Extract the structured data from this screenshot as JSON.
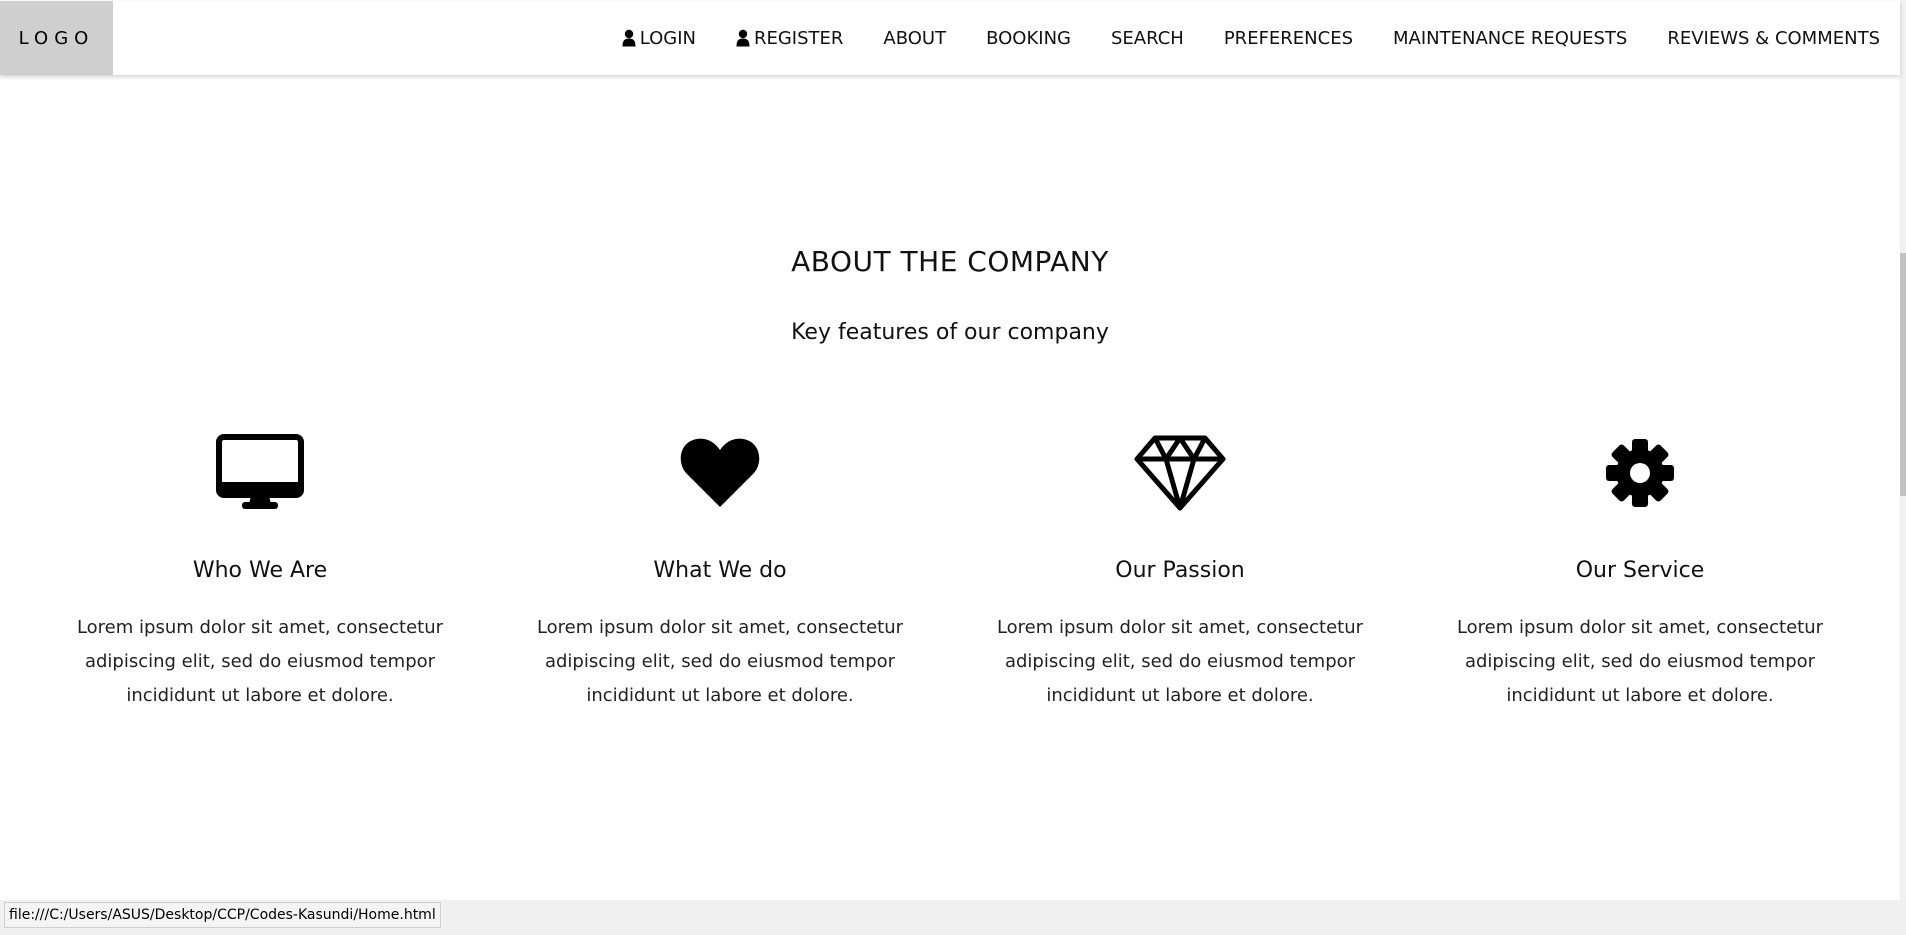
{
  "navbar": {
    "logo": "LOGO",
    "links": [
      {
        "label": "LOGIN",
        "icon": "user-icon"
      },
      {
        "label": "REGISTER",
        "icon": "user-icon"
      },
      {
        "label": "ABOUT"
      },
      {
        "label": "BOOKING"
      },
      {
        "label": "SEARCH"
      },
      {
        "label": "PREFERENCES"
      },
      {
        "label": "MAINTENANCE REQUESTS"
      },
      {
        "label": "REVIEWS & COMMENTS"
      }
    ]
  },
  "about": {
    "title": "ABOUT THE COMPANY",
    "subtitle": "Key features of our company",
    "features": [
      {
        "icon": "desktop-icon",
        "title": "Who We Are",
        "text": "Lorem ipsum dolor sit amet, consectetur adipiscing elit, sed do eiusmod tempor incididunt ut labore et dolore."
      },
      {
        "icon": "heart-icon",
        "title": "What We do",
        "text": "Lorem ipsum dolor sit amet, consectetur adipiscing elit, sed do eiusmod tempor incididunt ut labore et dolore."
      },
      {
        "icon": "diamond-icon",
        "title": "Our Passion",
        "text": "Lorem ipsum dolor sit amet, consectetur adipiscing elit, sed do eiusmod tempor incididunt ut labore et dolore."
      },
      {
        "icon": "gear-icon",
        "title": "Our Service",
        "text": "Lorem ipsum dolor sit amet, consectetur adipiscing elit, sed do eiusmod tempor incididunt ut labore et dolore."
      }
    ]
  },
  "status_bar": {
    "url": "file:///C:/Users/ASUS/Desktop/CCP/Codes-Kasundi/Home.html"
  },
  "colors": {
    "logo_background": "#cfcfcf",
    "text": "#111111",
    "background": "#ffffff"
  }
}
